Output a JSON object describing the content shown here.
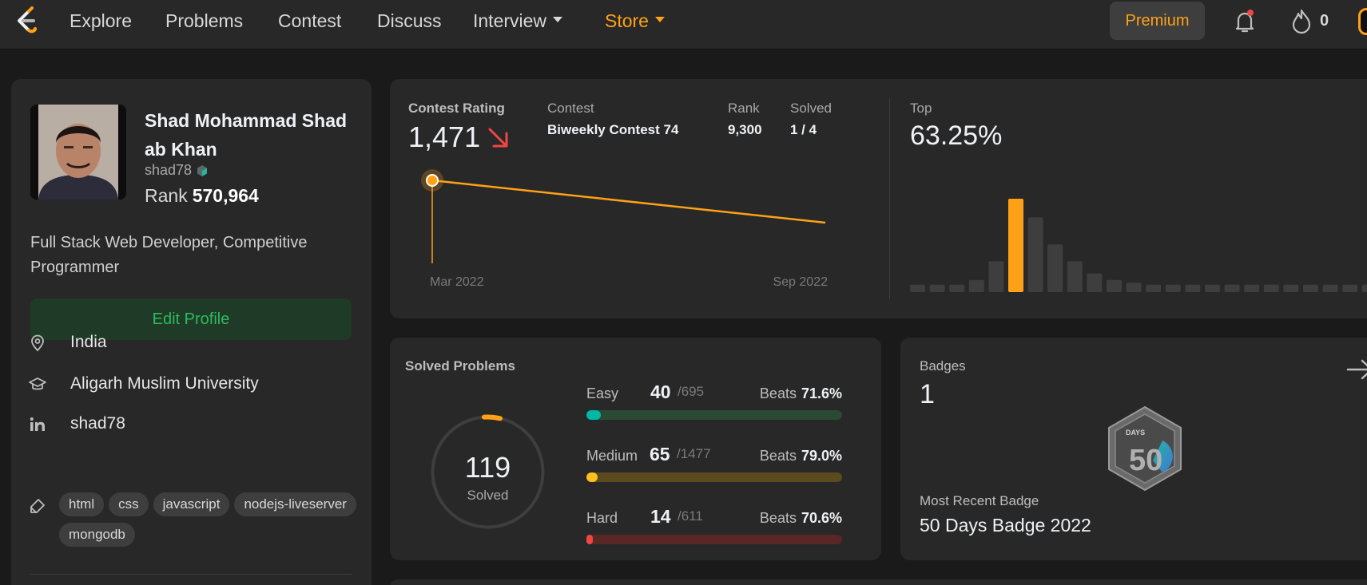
{
  "nav": {
    "logo_icon": "leetcode-logo-icon",
    "items": [
      "Explore",
      "Problems",
      "Contest",
      "Discuss",
      "Interview",
      "Store"
    ],
    "premium_label": "Premium",
    "bell_icon": "bell-icon",
    "streak_icon": "fire-icon",
    "streak_count": "0",
    "accent": "#ffa116"
  },
  "profile": {
    "name": "Shad Mohammad Shad ab Khan",
    "username": "shad78",
    "rank_label": "Rank",
    "rank_value": "570,964",
    "bio": "Full Stack Web Developer, Competitive Programmer",
    "edit_label": "Edit Profile",
    "location": "India",
    "school": "Aligarh Muslim University",
    "linkedin": "shad78",
    "skills": [
      "html",
      "css",
      "javascript",
      "nodejs-liveserver",
      "mongodb"
    ]
  },
  "contest": {
    "rating_label": "Contest Rating",
    "rating": "1,471",
    "contest_label": "Contest",
    "contest_name": "Biweekly Contest 74",
    "rank_label": "Rank",
    "rank": "9,300",
    "solved_label": "Solved",
    "solved": "1 / 4",
    "top_label": "Top",
    "top_value": "63.25%",
    "chart_x_start": "Mar 2022",
    "chart_x_end": "Sep 2022",
    "histogram_levels": [
      0.08,
      0.08,
      0.08,
      0.13,
      0.33,
      1.0,
      0.8,
      0.51,
      0.33,
      0.2,
      0.13,
      0.1,
      0.08,
      0.08,
      0.08,
      0.08,
      0.08,
      0.08,
      0.08,
      0.08,
      0.08,
      0.08,
      0.08,
      0.08,
      0.08
    ],
    "histogram_highlight_index": 5
  },
  "solved": {
    "title": "Solved Problems",
    "total": "119",
    "total_label": "Solved",
    "beats_label": "Beats",
    "rows": [
      {
        "name": "Easy",
        "solved": "40",
        "total": "/695",
        "beats": "71.6%",
        "fraction": 0.0576,
        "track": "#2a4a36",
        "fill": "#00b8a3"
      },
      {
        "name": "Medium",
        "solved": "65",
        "total": "/1477",
        "beats": "79.0%",
        "fraction": 0.044,
        "track": "#5a4a1e",
        "fill": "#ffc01e"
      },
      {
        "name": "Hard",
        "solved": "14",
        "total": "/611",
        "beats": "70.6%",
        "fraction": 0.023,
        "track": "#5a2626",
        "fill": "#ef4743"
      }
    ]
  },
  "badges": {
    "title": "Badges",
    "count": "1",
    "recent_label": "Most Recent Badge",
    "recent_name": "50 Days Badge 2022",
    "badge_text": "DAYS",
    "badge_number": "50"
  }
}
